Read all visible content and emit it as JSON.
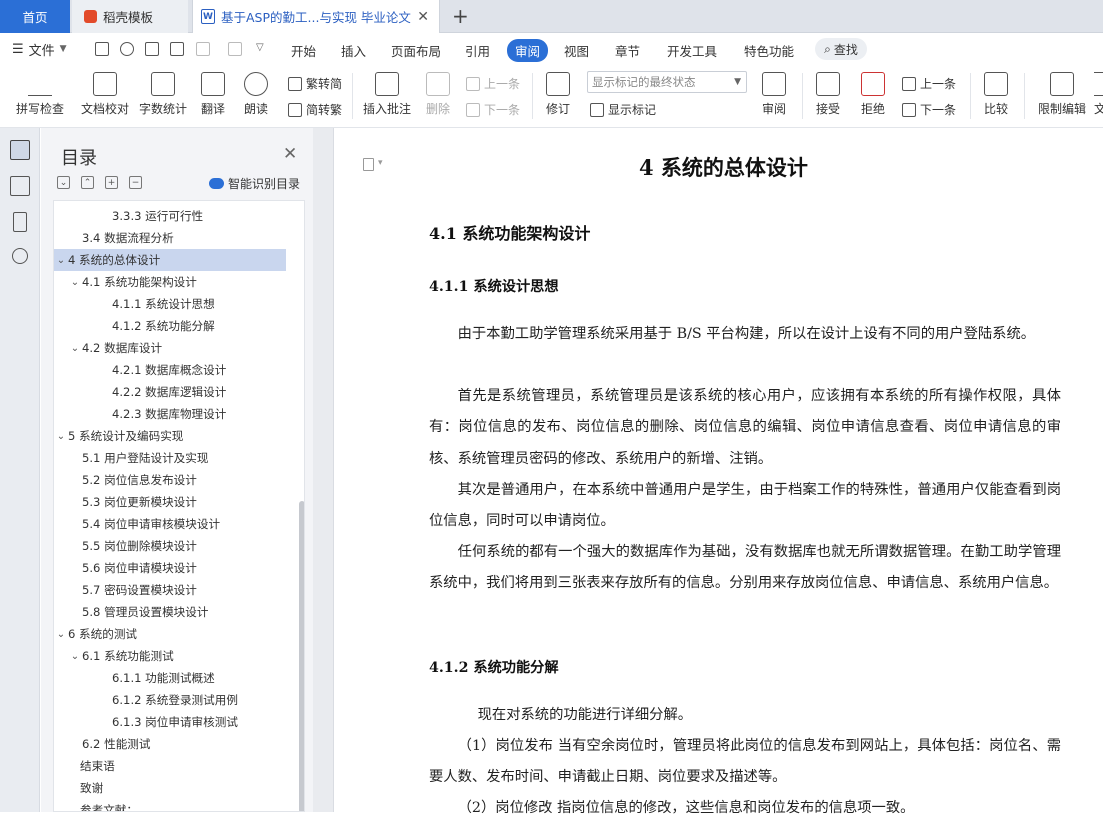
{
  "tabs": {
    "home": "首页",
    "templates": "稻壳模板",
    "document": "基于ASP的勤工...与实现 毕业论文"
  },
  "menubar": {
    "file": "文件",
    "items": [
      "开始",
      "插入",
      "页面布局",
      "引用",
      "审阅",
      "视图",
      "章节",
      "开发工具",
      "特色功能"
    ],
    "active": "审阅",
    "search": "查找"
  },
  "ribbon": {
    "spell_check": "拼写检查",
    "doc_proof": "文档校对",
    "word_count": "字数统计",
    "translate": "翻译",
    "read_aloud": "朗读",
    "to_simplified": "繁转简",
    "to_traditional": "简转繁",
    "insert_comment": "插入批注",
    "delete": "删除",
    "prev_comment": "上一条",
    "next_comment": "下一条",
    "revise": "修订",
    "markup_select": "显示标记的最终状态",
    "show_markup": "显示标记",
    "review": "审阅",
    "accept": "接受",
    "reject": "拒绝",
    "prev_change": "上一条",
    "next_change": "下一条",
    "compare": "比较",
    "restrict_edit": "限制编辑",
    "more": "文"
  },
  "toc": {
    "title": "目录",
    "smart_label": "智能识别目录",
    "items": [
      {
        "text": "3.3.3  运行可行性",
        "level": 3
      },
      {
        "text": "3.4  数据流程分析",
        "level": 2
      },
      {
        "text": "4   系统的总体设计",
        "level": 1,
        "expanded": true,
        "selected": true
      },
      {
        "text": "4.1 系统功能架构设计",
        "level": 2,
        "expanded": true
      },
      {
        "text": "4.1.1 系统设计思想",
        "level": 3
      },
      {
        "text": "4.1.2  系统功能分解",
        "level": 3
      },
      {
        "text": "4.2  数据库设计",
        "level": 2,
        "expanded": true
      },
      {
        "text": "4.2.1  数据库概念设计",
        "level": 3
      },
      {
        "text": "4.2.2  数据库逻辑设计",
        "level": 3
      },
      {
        "text": "4.2.3  数据库物理设计",
        "level": 3
      },
      {
        "text": "5    系统设计及编码实现",
        "level": 1,
        "expanded": true
      },
      {
        "text": "5.1  用户登陆设计及实现",
        "level": 2
      },
      {
        "text": "5.2  岗位信息发布设计",
        "level": 2
      },
      {
        "text": "5.3 岗位更新模块设计",
        "level": 2
      },
      {
        "text": "5.4  岗位申请审核模块设计",
        "level": 2
      },
      {
        "text": "5.5  岗位删除模块设计",
        "level": 2
      },
      {
        "text": "5.6  岗位申请模块设计",
        "level": 2
      },
      {
        "text": "5.7  密码设置模块设计",
        "level": 2
      },
      {
        "text": "5.8  管理员设置模块设计",
        "level": 2
      },
      {
        "text": "6  系统的测试",
        "level": 1,
        "expanded": true
      },
      {
        "text": "6.1 系统功能测试",
        "level": 2,
        "expanded": true
      },
      {
        "text": "6.1.1  功能测试概述",
        "level": 3
      },
      {
        "text": "6.1.2  系统登录测试用例",
        "level": 3
      },
      {
        "text": "6.1.3  岗位申请审核测试",
        "level": 3
      },
      {
        "text": "6.2  性能测试",
        "level": 2
      },
      {
        "text": "结束语",
        "level": 0
      },
      {
        "text": "致谢",
        "level": 0
      },
      {
        "text": "参考文献：",
        "level": 0
      }
    ]
  },
  "document": {
    "chapter_title": "4   系统的总体设计",
    "section_title": "4.1 系统功能架构设计",
    "sub1_title": "4.1.1 系统设计思想",
    "p1": "由于本勤工助学管理系统采用基于 B/S 平台构建，所以在设计上设有不同的用户登陆系统。",
    "p2": "首先是系统管理员，系统管理员是该系统的核心用户，应该拥有本系统的所有操作权限，具体有：岗位信息的发布、岗位信息的删除、岗位信息的编辑、岗位申请信息查看、岗位申请信息的审核、系统管理员密码的修改、系统用户的新增、注销。",
    "p3": "其次是普通用户，在本系统中普通用户是学生，由于档案工作的特殊性，普通用户仅能查看到岗位信息，同时可以申请岗位。",
    "p4": "任何系统的都有一个强大的数据库作为基础，没有数据库也就无所谓数据管理。在勤工助学管理系统中，我们将用到三张表来存放所有的信息。分别用来存放岗位信息、申请信息、系统用户信息。",
    "sub2_title": "4.1.2 系统功能分解",
    "p5": "现在对系统的功能进行详细分解。",
    "p6": "（1）岗位发布 当有空余岗位时，管理员将此岗位的信息发布到网站上，具体包括：岗位名、需要人数、发布时间、申请截止日期、岗位要求及描述等。",
    "p7": "（2）岗位修改 指岗位信息的修改，这些信息和岗位发布的信息项一致。"
  }
}
